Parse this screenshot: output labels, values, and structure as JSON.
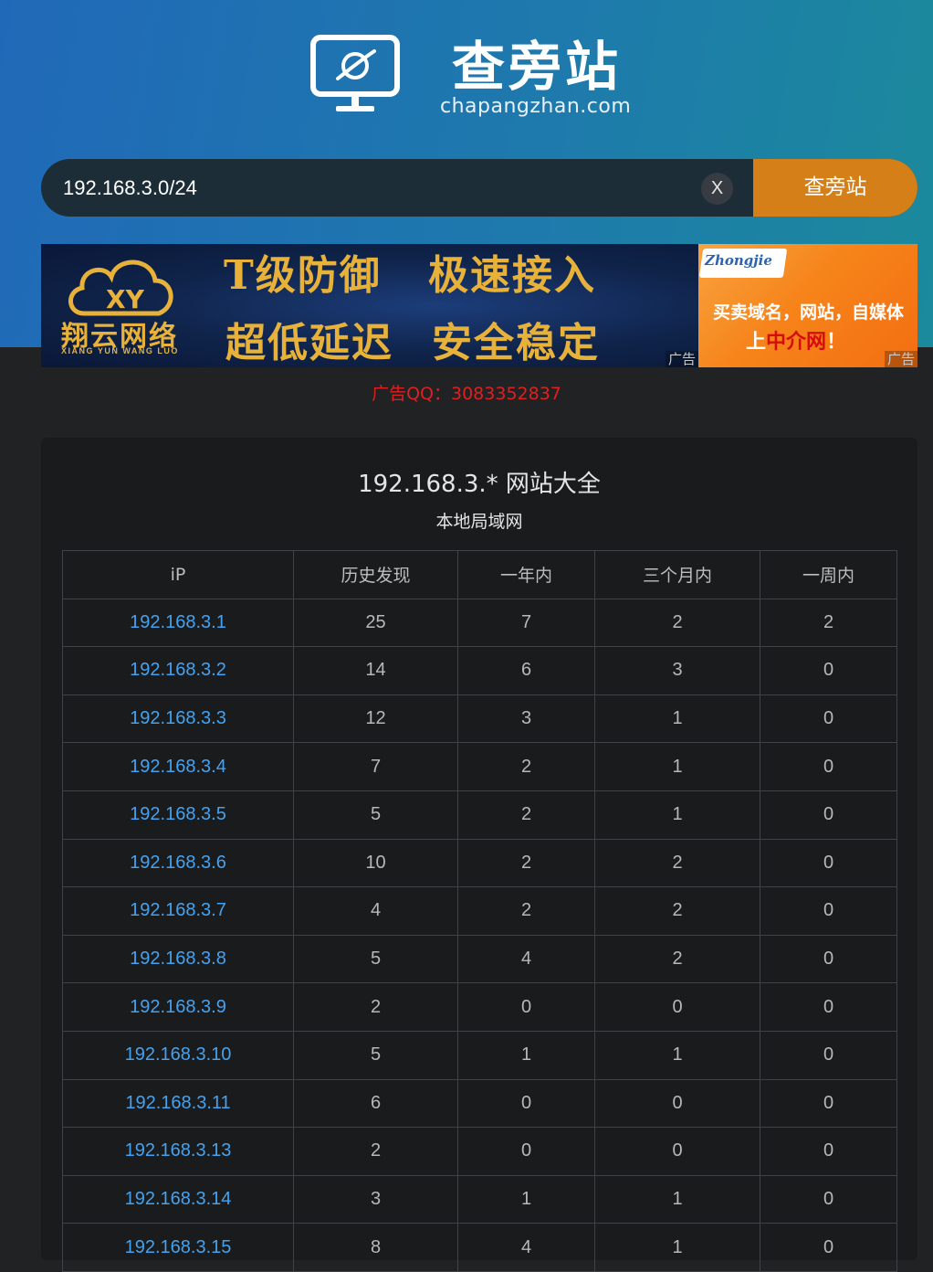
{
  "logo": {
    "title_cn": "查旁站",
    "domain": "chapangzhan.com"
  },
  "search": {
    "value": "192.168.3.0/24",
    "clear_label": "X",
    "button_label": "查旁站"
  },
  "ads": {
    "banner1": {
      "brand_cn": "翔云网络",
      "brand_en": "XIANG YUN WANG LUO",
      "slogans": [
        "T级防御",
        "极速接入",
        "超低延迟",
        "安全稳定"
      ],
      "tag": "广告"
    },
    "banner2": {
      "logo": "Zhongjie",
      "line1": "买卖域名，网站，自媒体",
      "line2_prefix": "上",
      "line2_highlight": "中介网",
      "line2_suffix": "！",
      "tag": "广告"
    },
    "contact": "广告QQ：3083352837"
  },
  "panel": {
    "title": "192.168.3.* 网站大全",
    "subtitle": "本地局域网",
    "columns": [
      "iP",
      "历史发现",
      "一年内",
      "三个月内",
      "一周内"
    ],
    "rows": [
      [
        "192.168.3.1",
        "25",
        "7",
        "2",
        "2"
      ],
      [
        "192.168.3.2",
        "14",
        "6",
        "3",
        "0"
      ],
      [
        "192.168.3.3",
        "12",
        "3",
        "1",
        "0"
      ],
      [
        "192.168.3.4",
        "7",
        "2",
        "1",
        "0"
      ],
      [
        "192.168.3.5",
        "5",
        "2",
        "1",
        "0"
      ],
      [
        "192.168.3.6",
        "10",
        "2",
        "2",
        "0"
      ],
      [
        "192.168.3.7",
        "4",
        "2",
        "2",
        "0"
      ],
      [
        "192.168.3.8",
        "5",
        "4",
        "2",
        "0"
      ],
      [
        "192.168.3.9",
        "2",
        "0",
        "0",
        "0"
      ],
      [
        "192.168.3.10",
        "5",
        "1",
        "1",
        "0"
      ],
      [
        "192.168.3.11",
        "6",
        "0",
        "0",
        "0"
      ],
      [
        "192.168.3.13",
        "2",
        "0",
        "0",
        "0"
      ],
      [
        "192.168.3.14",
        "3",
        "1",
        "1",
        "0"
      ],
      [
        "192.168.3.15",
        "8",
        "4",
        "1",
        "0"
      ]
    ]
  }
}
